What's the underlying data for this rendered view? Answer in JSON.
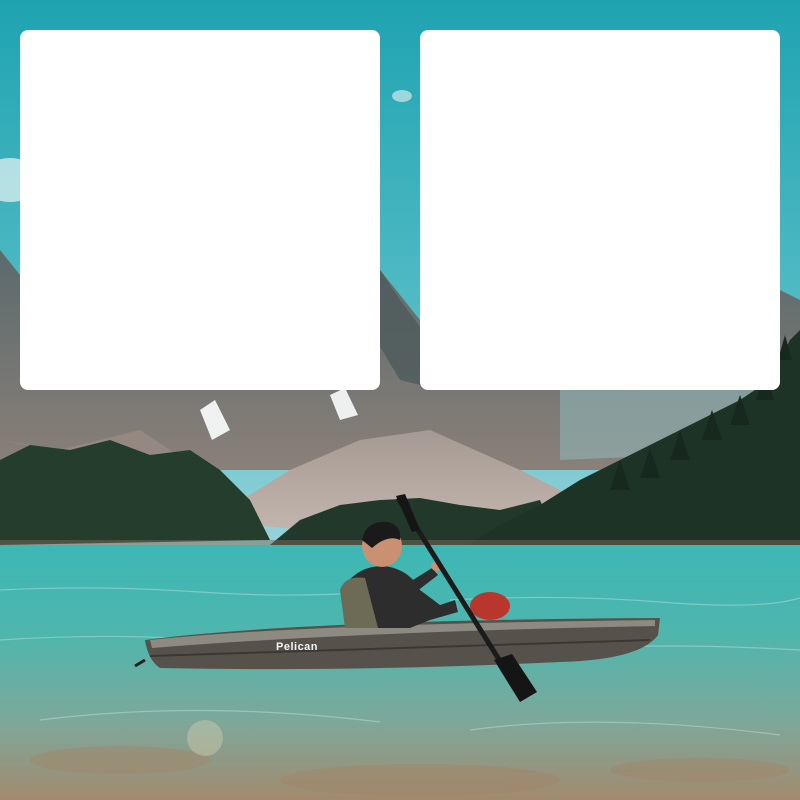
{
  "scene": {
    "description_icon": "kayak-lake-photo",
    "kayak_brand": "Pelican",
    "colors": {
      "sky_top": "#27a9b5",
      "sky_bottom": "#7cc9d2",
      "water": "#3fb3ae",
      "water_deep": "#2a8f8c",
      "forest": "#1f3a2c",
      "mountain": "#6b6a68",
      "kayak": "#55524c"
    }
  },
  "cards": [
    {
      "id": "left",
      "content": ""
    },
    {
      "id": "right",
      "content": ""
    }
  ]
}
